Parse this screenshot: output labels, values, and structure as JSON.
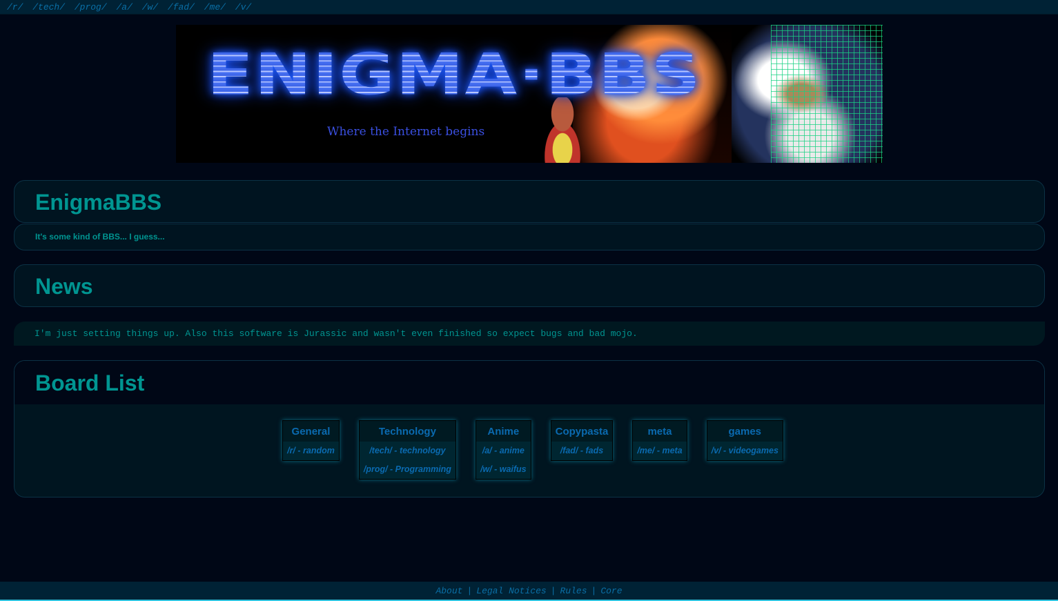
{
  "topnav": {
    "links": [
      "/r/",
      "/tech/",
      "/prog/",
      "/a/",
      "/w/",
      "/fad/",
      "/me/",
      "/v/"
    ]
  },
  "banner": {
    "logo": "ENIGMA·BBS",
    "tagline": "Where the Internet begins"
  },
  "site": {
    "title": "EnigmaBBS",
    "subtitle": "It's some kind of BBS... I guess..."
  },
  "news": {
    "title": "News",
    "body": "I'm just setting things up. Also this software is Jurassic and wasn't even finished so expect bugs and bad mojo."
  },
  "boards": {
    "title": "Board List",
    "categories": [
      {
        "name": "General",
        "boards": [
          "/r/ - random"
        ]
      },
      {
        "name": "Technology",
        "boards": [
          "/tech/ - technology",
          "/prog/ - Programming"
        ]
      },
      {
        "name": "Anime",
        "boards": [
          "/a/ - anime",
          "/w/ - waifus"
        ]
      },
      {
        "name": "Copypasta",
        "boards": [
          "/fad/ - fads"
        ]
      },
      {
        "name": "meta",
        "boards": [
          "/me/ - meta"
        ]
      },
      {
        "name": "games",
        "boards": [
          "/v/ - videogames"
        ]
      }
    ]
  },
  "footer": {
    "links": [
      "About",
      "Legal Notices",
      "Rules",
      "Core"
    ],
    "separator": "|"
  },
  "colors": {
    "background": "#000716",
    "accent": "#009591",
    "link": "#0a6fa6",
    "panel": "#001420",
    "footer_border": "#31c5e0"
  }
}
